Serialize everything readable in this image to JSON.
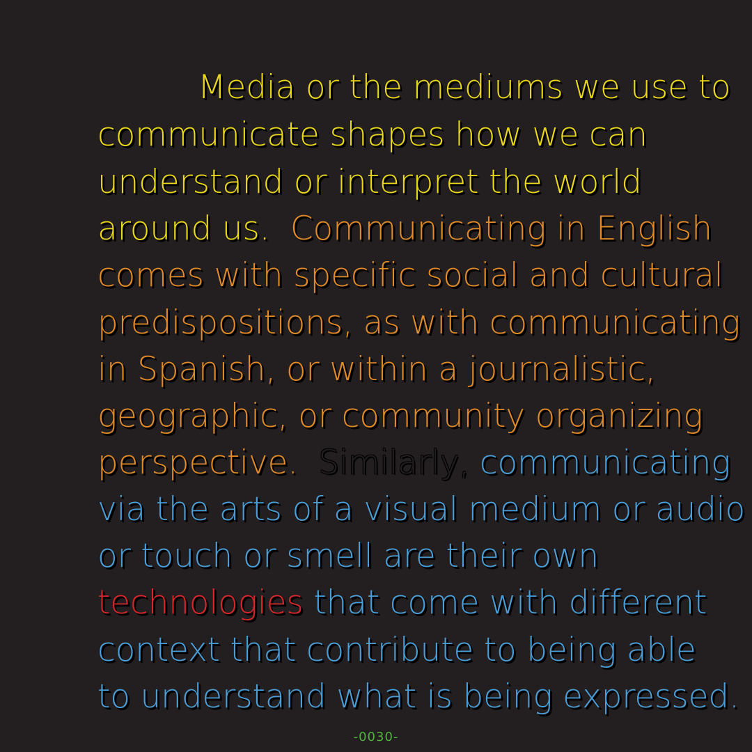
{
  "poem": {
    "lines": [
      [
        {
          "text": "Media or the mediums we use to",
          "color": "yellow"
        }
      ],
      [
        {
          "text": "communicate shapes how we can",
          "color": "yellow"
        }
      ],
      [
        {
          "text": "understand or interpret the world",
          "color": "yellow"
        }
      ],
      [
        {
          "text": "around us.  ",
          "color": "yellow"
        },
        {
          "text": "Communicating in English",
          "color": "orange"
        }
      ],
      [
        {
          "text": "comes with specific social and cultural",
          "color": "orange"
        }
      ],
      [
        {
          "text": "predispositions, as with communicating",
          "color": "orange"
        }
      ],
      [
        {
          "text": "in Spanish, or within a journalistic,",
          "color": "orange"
        }
      ],
      [
        {
          "text": "geographic, or community organizing",
          "color": "orange"
        }
      ],
      [
        {
          "text": "perspective.  ",
          "color": "orange"
        },
        {
          "text": "Similarly,",
          "color": "dark"
        },
        {
          "text": " communicating",
          "color": "blue"
        }
      ],
      [
        {
          "text": "via the arts of a visual medium or audio",
          "color": "blue"
        }
      ],
      [
        {
          "text": "or touch or smell are their own",
          "color": "blue"
        }
      ],
      [
        {
          "text": "technologies",
          "color": "red"
        },
        {
          "text": " that come with different",
          "color": "blue"
        }
      ],
      [
        {
          "text": "context that contribute to being able",
          "color": "blue"
        }
      ],
      [
        {
          "text": "to understand what is being expressed.",
          "color": "blue"
        }
      ]
    ]
  },
  "page_number": "-0030-",
  "colors": {
    "background": "#231f20",
    "yellow": "#ead81a",
    "orange": "#e08a28",
    "blue": "#4a9fd8",
    "red": "#d8262b",
    "dark": "#231f20",
    "page_number": "#4fb33c"
  }
}
